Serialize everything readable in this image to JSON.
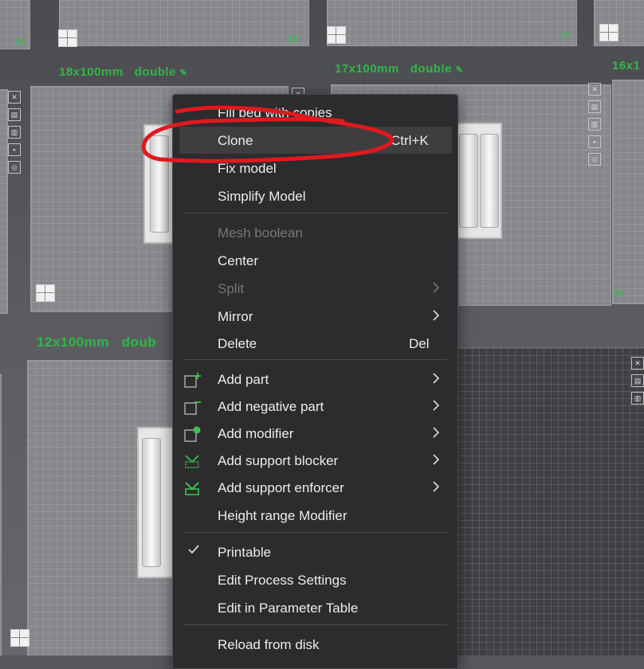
{
  "plates": {
    "numbers": [
      "15",
      "16",
      "17",
      "23"
    ],
    "labels": [
      {
        "size": "18x100mm",
        "mode": "double"
      },
      {
        "size": "17x100mm",
        "mode": "double"
      },
      {
        "size": "16x1",
        "mode": ""
      },
      {
        "size": "12x100mm",
        "mode": "doub"
      }
    ]
  },
  "context_menu": {
    "items": [
      {
        "label": "Fill bed with copies"
      },
      {
        "label": "Clone",
        "shortcut": "Ctrl+K"
      },
      {
        "label": "Fix model"
      },
      {
        "label": "Simplify Model"
      },
      {
        "label": "Mesh boolean",
        "disabled": true
      },
      {
        "label": "Center"
      },
      {
        "label": "Split",
        "disabled": true,
        "submenu": true
      },
      {
        "label": "Mirror",
        "submenu": true
      },
      {
        "label": "Delete",
        "shortcut": "Del"
      },
      {
        "label": "Add part",
        "icon": "add-part-icon",
        "submenu": true
      },
      {
        "label": "Add negative part",
        "icon": "negative-part-icon",
        "submenu": true
      },
      {
        "label": "Add modifier",
        "icon": "modifier-icon",
        "submenu": true
      },
      {
        "label": "Add support blocker",
        "icon": "support-blocker-icon",
        "submenu": true
      },
      {
        "label": "Add support enforcer",
        "icon": "support-enforcer-icon",
        "submenu": true
      },
      {
        "label": "Height range Modifier"
      },
      {
        "label": "Printable",
        "checked": true
      },
      {
        "label": "Edit Process Settings"
      },
      {
        "label": "Edit in Parameter Table"
      },
      {
        "label": "Reload from disk"
      }
    ]
  },
  "annotation": {
    "color": "#e0191f",
    "target": "Clone"
  },
  "colors": {
    "accent_green": "#2fb846",
    "menu_bg": "#2c2c2e",
    "menu_text": "#ececec"
  }
}
